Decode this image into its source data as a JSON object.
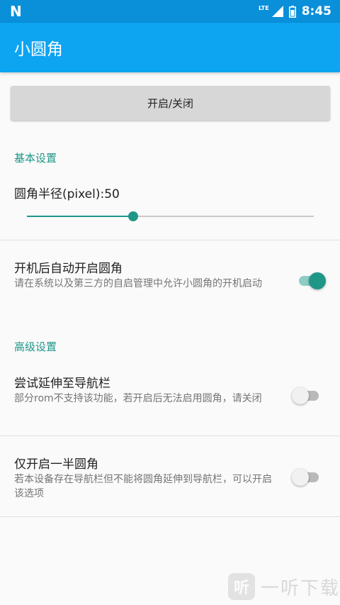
{
  "status_bar": {
    "logo": "N",
    "network": "LTE",
    "time": "8:45",
    "icons": [
      "signal-icon",
      "battery-icon"
    ]
  },
  "app_bar": {
    "title": "小圆角"
  },
  "toggle_button": {
    "label": "开启/关闭"
  },
  "basic_settings": {
    "header": "基本设置",
    "radius": {
      "label": "圆角半径(pixel):50",
      "value": 50,
      "fraction": 0.37
    },
    "autostart": {
      "title": "开机后自动开启圆角",
      "summary": "请在系统以及第三方的自启管理中允许小圆角的开机启动",
      "enabled": true
    }
  },
  "advanced_settings": {
    "header": "高级设置",
    "extend_navbar": {
      "title": "尝试延伸至导航栏",
      "summary": "部分rom不支持该功能，若开启后无法启用圆角，请关闭",
      "enabled": false
    },
    "half_corners": {
      "title": "仅开启一半圆角",
      "summary": "若本设备存在导航栏但不能将圆角延伸到导航栏，可以开启该选项",
      "enabled": false
    }
  },
  "colors": {
    "status_bar": "#0a8fd9",
    "app_bar": "#0da4f2",
    "accent": "#1e9688"
  },
  "watermark": {
    "logo": "听",
    "text": "一听下载"
  }
}
